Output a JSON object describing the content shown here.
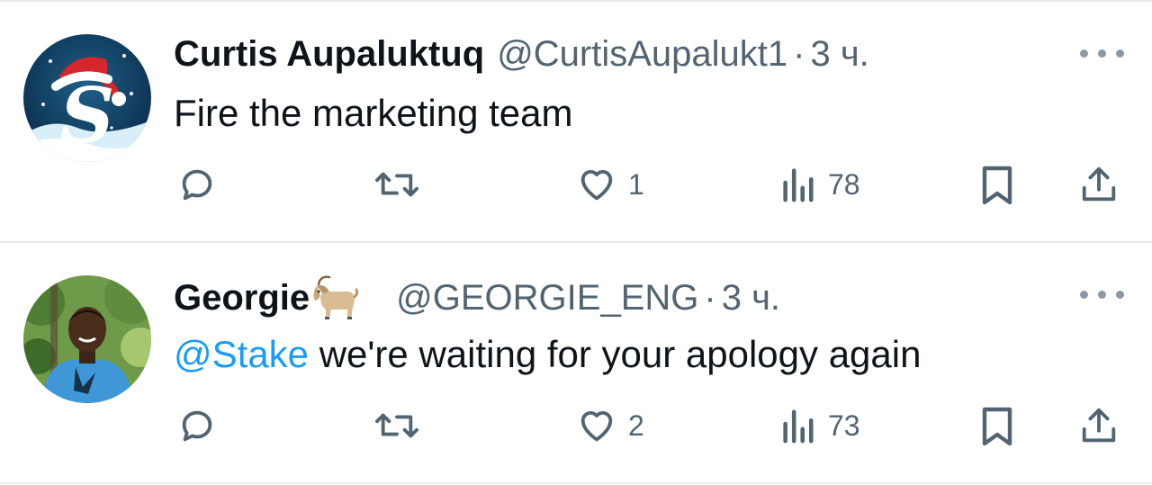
{
  "colors": {
    "text": "#0f1419",
    "secondary": "#536471",
    "link": "#1d9bf0",
    "divider": "#e7e9ec"
  },
  "tweets": [
    {
      "author_name": "Curtis Aupaluktuq",
      "handle": "@CurtisAupalukt1",
      "separator": "·",
      "time": "3 ч.",
      "text": "Fire the marketing team",
      "avatar_icon": "santa-hat-s-logo",
      "actions": {
        "reply_icon": "reply-icon",
        "retweet_icon": "retweet-icon",
        "like_icon": "heart-icon",
        "like_count": "1",
        "views_icon": "views-icon",
        "view_count": "78",
        "bookmark_icon": "bookmark-icon",
        "share_icon": "share-icon"
      }
    },
    {
      "author_name": "Georgie",
      "author_emoji": "goat",
      "handle": "@GEORGIE_ENG",
      "separator": "·",
      "time": "3 ч.",
      "mention": "@Stake",
      "text": " we're waiting for your apology again",
      "avatar_icon": "user-photo",
      "actions": {
        "reply_icon": "reply-icon",
        "retweet_icon": "retweet-icon",
        "like_icon": "heart-icon",
        "like_count": "2",
        "views_icon": "views-icon",
        "view_count": "73",
        "bookmark_icon": "bookmark-icon",
        "share_icon": "share-icon"
      }
    }
  ]
}
